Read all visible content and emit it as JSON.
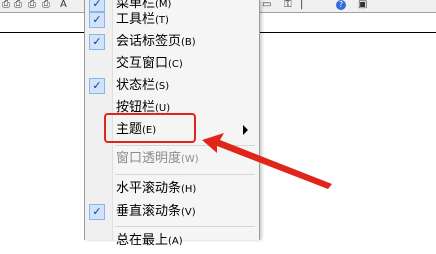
{
  "toolbar": {
    "icons": [
      "print-icon",
      "print-preview-icon",
      "copy-icon",
      "help-icon"
    ]
  },
  "menu": {
    "items": [
      {
        "label": "菜单栏",
        "accel": "(M)",
        "checked": true,
        "disabled": false
      },
      {
        "label": "工具栏",
        "accel": "(T)",
        "checked": true,
        "disabled": false
      },
      {
        "label": "会话标签页",
        "accel": "(B)",
        "checked": true,
        "disabled": false
      },
      {
        "label": "交互窗口",
        "accel": "(C)",
        "checked": false,
        "disabled": false
      },
      {
        "label": "状态栏",
        "accel": "(S)",
        "checked": true,
        "disabled": false
      },
      {
        "label": "按钮栏",
        "accel": "(U)",
        "checked": false,
        "disabled": false
      },
      {
        "label": "主题",
        "accel": "(E)",
        "checked": false,
        "disabled": false,
        "submenu": true
      },
      {
        "label": "窗口透明度",
        "accel": "(W)",
        "checked": false,
        "disabled": true
      },
      {
        "label": "水平滚动条",
        "accel": "(H)",
        "checked": false,
        "disabled": false
      },
      {
        "label": "垂直滚动条",
        "accel": "(V)",
        "checked": true,
        "disabled": false
      },
      {
        "label": "总在最上",
        "accel": "(A)",
        "checked": false,
        "disabled": false
      }
    ]
  },
  "annotation": {
    "color": "#e0261b"
  }
}
